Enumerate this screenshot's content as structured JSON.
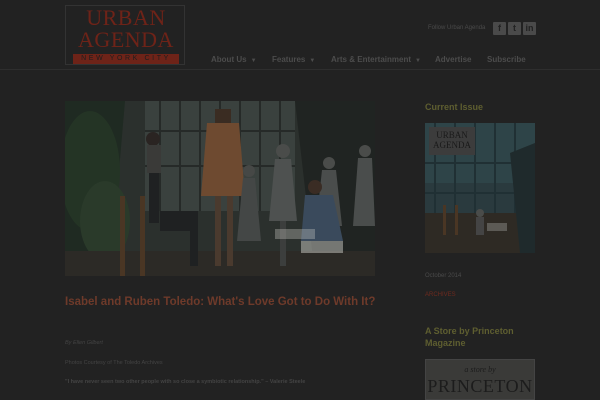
{
  "header": {
    "logo_line1": "URBAN",
    "logo_line2": "AGENDA",
    "logo_sub": "NEW YORK CITY",
    "follow_text": "Follow Urban Agenda",
    "social": [
      {
        "icon": "facebook-icon",
        "glyph": "f"
      },
      {
        "icon": "twitter-icon",
        "glyph": "t"
      },
      {
        "icon": "linkedin-icon",
        "glyph": "in"
      }
    ]
  },
  "nav": [
    {
      "label": "About Us",
      "has_dropdown": true
    },
    {
      "label": "Features",
      "has_dropdown": true
    },
    {
      "label": "Arts & Entertainment",
      "has_dropdown": true
    },
    {
      "label": "Advertise",
      "has_dropdown": false
    },
    {
      "label": "Subscribe",
      "has_dropdown": false
    }
  ],
  "article": {
    "title": "Isabel and Ruben Toledo: What's Love Got to Do With It?",
    "byline": "By Ellen Gilbert",
    "credit": "Photos Courtesy of The Toledo Archives",
    "quote": "\"I have never seen two other people with so close a symbiotic relationship.\" – Valerie Steele"
  },
  "sidebar": {
    "current_issue_heading": "Current Issue",
    "cover_logo_line1": "URBAN",
    "cover_logo_line2": "AGENDA",
    "issue_date": "October 2014",
    "archives_label": "ARCHIVES",
    "store_heading": "A Store by Princeton Magazine",
    "store_banner_small": "a store by",
    "store_banner_big": "PRINCETON"
  },
  "colors": {
    "background": "#222222",
    "accent": "#6e2318",
    "sidebar_heading": "#5e5e30"
  }
}
